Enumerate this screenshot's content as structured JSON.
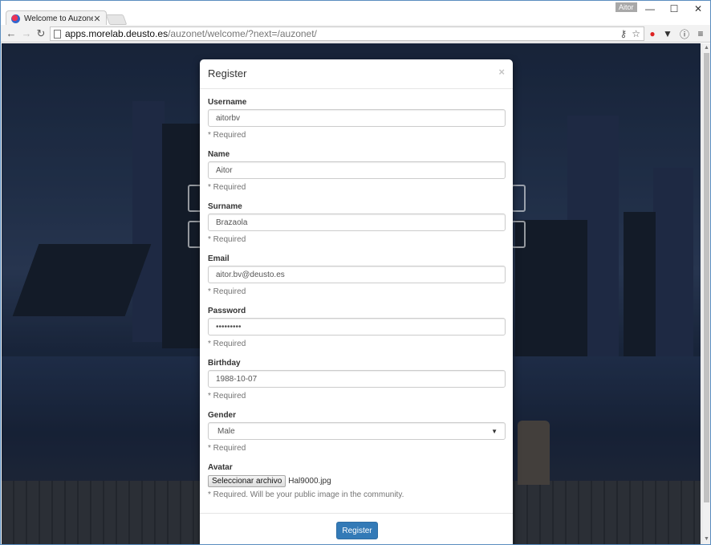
{
  "browser": {
    "tab_title": "Welcome to Auzonet",
    "tab_close": "✕",
    "user_badge": "Aitor",
    "win_minimize": "—",
    "win_maximize": "☐",
    "win_close": "✕",
    "back": "←",
    "forward": "→",
    "reload": "↻",
    "url_host": "apps.morelab.deusto.es",
    "url_path": "/auzonet/welcome/?next=/auzonet/",
    "icons": [
      "key-icon",
      "star-icon",
      "opera-icon",
      "pocket-icon",
      "info-icon",
      "menu-icon"
    ]
  },
  "modal": {
    "title": "Register",
    "close": "×",
    "fields": [
      {
        "label": "Username",
        "value": "aitorbv",
        "help": "* Required"
      },
      {
        "label": "Name",
        "value": "Aitor",
        "help": "* Required"
      },
      {
        "label": "Surname",
        "value": "Brazaola",
        "help": "* Required"
      },
      {
        "label": "Email",
        "value": "aitor.bv@deusto.es",
        "help": "* Required"
      },
      {
        "label": "Password",
        "value": "•••••••••",
        "help": "* Required"
      },
      {
        "label": "Birthday",
        "value": "1988-10-07",
        "help": "* Required"
      },
      {
        "label": "Gender",
        "value": "Male",
        "help": "* Required"
      }
    ],
    "avatar": {
      "label": "Avatar",
      "button": "Seleccionar archivo",
      "file": "Hal9000.jpg",
      "help": "* Required. Will be your public image in the community."
    },
    "submit": "Register"
  },
  "colors": {
    "primary": "#337ab7",
    "window_border": "#5b8dbf"
  }
}
